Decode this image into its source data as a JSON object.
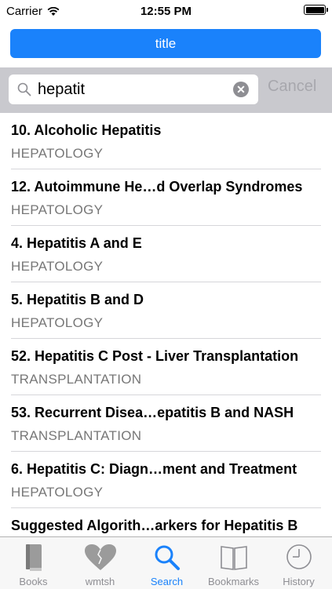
{
  "status": {
    "carrier": "Carrier",
    "time": "12:55 PM"
  },
  "header": {
    "title_button": "title"
  },
  "search": {
    "query": "hepatit",
    "cancel_label": "Cancel"
  },
  "results": [
    {
      "title": "10. Alcoholic Hepatitis",
      "section": "HEPATOLOGY"
    },
    {
      "title": "12. Autoimmune He…d Overlap Syndromes",
      "section": "HEPATOLOGY"
    },
    {
      "title": "4. Hepatitis A and E",
      "section": "HEPATOLOGY"
    },
    {
      "title": "5. Hepatitis B and D",
      "section": "HEPATOLOGY"
    },
    {
      "title": "52. Hepatitis C Post - Liver Transplantation",
      "section": "TRANSPLANTATION"
    },
    {
      "title": "53. Recurrent Disea…epatitis B and NASH",
      "section": "TRANSPLANTATION"
    },
    {
      "title": "6. Hepatitis C: Diagn…ment and Treatment",
      "section": "HEPATOLOGY"
    },
    {
      "title": "Suggested Algorith…arkers for Hepatitis B",
      "section": ""
    }
  ],
  "tabs": [
    {
      "label": "Books",
      "icon": "book-icon"
    },
    {
      "label": "wmtsh",
      "icon": "heart-icon"
    },
    {
      "label": "Search",
      "icon": "search-icon"
    },
    {
      "label": "Bookmarks",
      "icon": "bookmark-icon"
    },
    {
      "label": "History",
      "icon": "clock-icon"
    }
  ],
  "colors": {
    "accent": "#1a82fb",
    "search_bg": "#c9c9ce",
    "inactive_tab": "#8e8e93"
  }
}
